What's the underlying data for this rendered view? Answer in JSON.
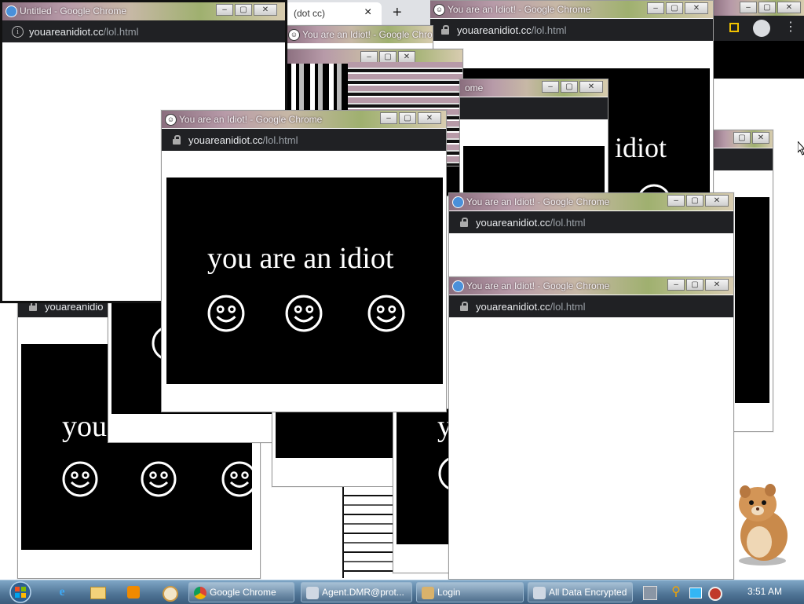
{
  "untitled_window": {
    "title": "Untitled - Google Chrome",
    "url_host": "youareanidiot.cc",
    "url_path": "/lol.html"
  },
  "idiot_window_title": "You are an Idiot! - Google Chrome",
  "url_host": "youareanidiot.cc",
  "url_path": "/lol.html",
  "message": "you are an idiot",
  "message_partial_1": "idiot",
  "message_partial_2": "you",
  "message_partial_3": "y",
  "tab_label": "(dot cc)",
  "tab_close": "×",
  "new_tab": "+",
  "url_host_partial": "youareanidio",
  "title_partial_1": "You are an Idiot! - Google Chro",
  "title_partial_2": "ome",
  "taskbar": {
    "items": [
      {
        "label": "Google Chrome"
      },
      {
        "label": "Agent.DMR@prot..."
      },
      {
        "label": "Login"
      },
      {
        "label": "All Data Encrypted"
      }
    ],
    "clock": "3:51 AM"
  },
  "colors": {
    "page_bg": "#000000",
    "addr_bar": "#202124",
    "taskbar": "#4e7394"
  }
}
